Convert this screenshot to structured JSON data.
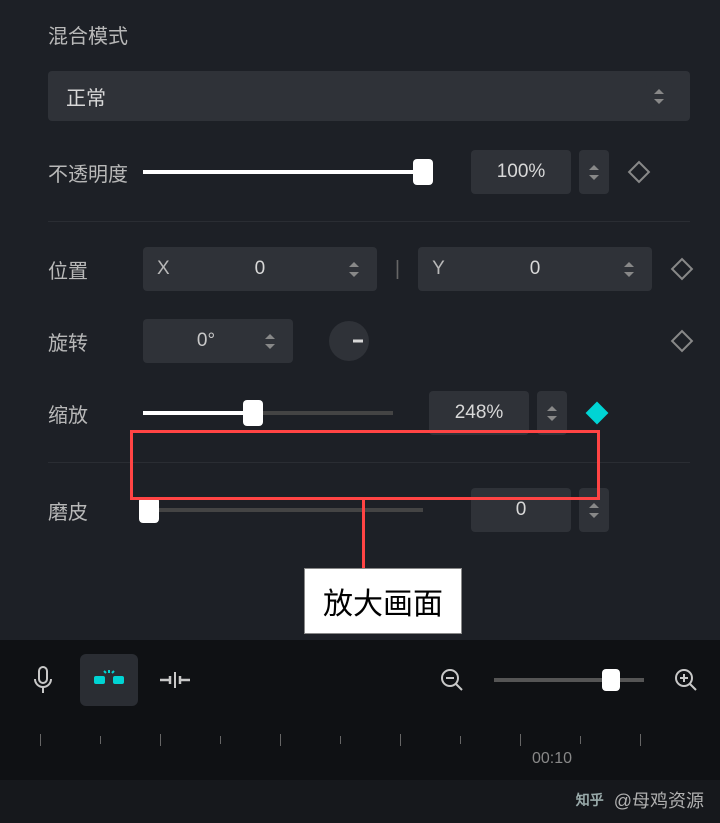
{
  "blendMode": {
    "label": "混合模式",
    "value": "正常"
  },
  "opacity": {
    "label": "不透明度",
    "value": "100%",
    "percent": 100
  },
  "position": {
    "label": "位置",
    "xLabel": "X",
    "x": "0",
    "yLabel": "Y",
    "y": "0",
    "sep": "|"
  },
  "rotation": {
    "label": "旋转",
    "value": "0°"
  },
  "scale": {
    "label": "缩放",
    "value": "248%",
    "percent": 44
  },
  "smooth": {
    "label": "磨皮",
    "value": "0",
    "percent": 2
  },
  "callout": "放大画面",
  "timeline": {
    "label": "00:10"
  },
  "watermark": {
    "site": "知乎",
    "user": "@母鸡资源"
  },
  "zoom": {
    "percent": 78
  }
}
